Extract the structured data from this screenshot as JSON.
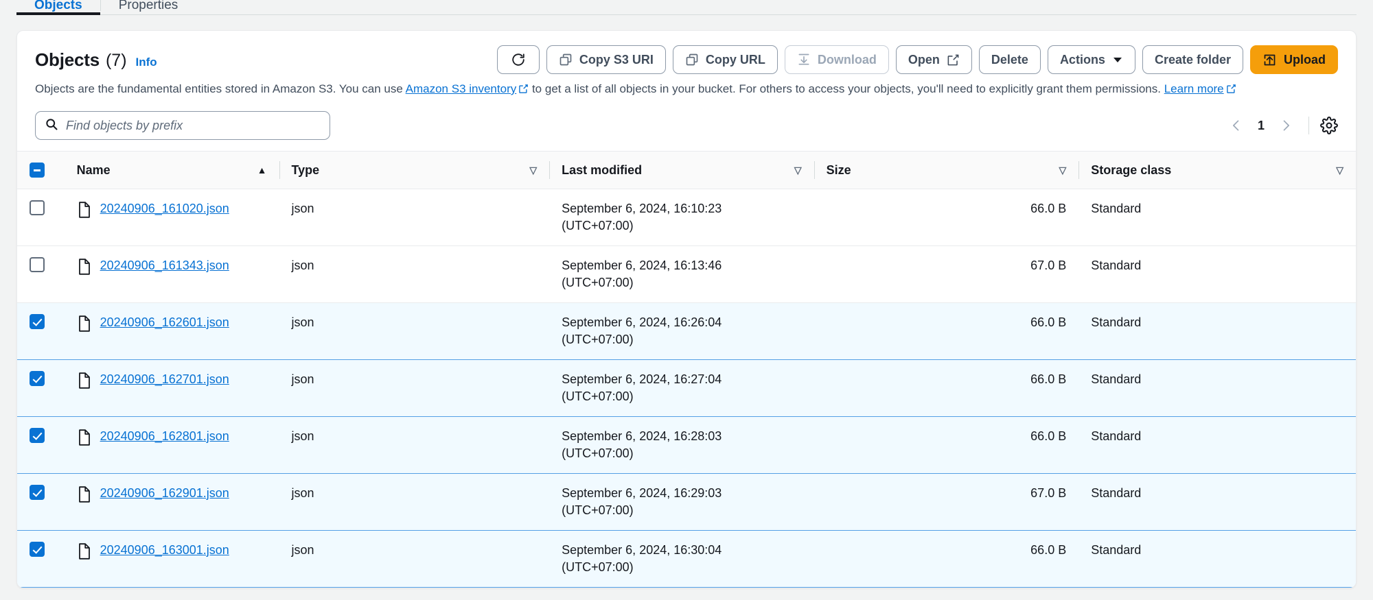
{
  "tabs": [
    {
      "label": "Objects",
      "active": true
    },
    {
      "label": "Properties",
      "active": false
    }
  ],
  "panel": {
    "title": "Objects",
    "count": "(7)",
    "info_label": "Info",
    "description_part1": "Objects are the fundamental entities stored in Amazon S3. You can use ",
    "inventory_link": "Amazon S3 inventory",
    "description_part2": " to get a list of all objects in your bucket. For others to access your objects, you'll need to explicitly grant them permissions. ",
    "learn_more_link": "Learn more"
  },
  "toolbar": {
    "refresh_icon": "refresh-icon",
    "copy_s3_uri": "Copy S3 URI",
    "copy_url": "Copy URL",
    "download": "Download",
    "open": "Open",
    "delete": "Delete",
    "actions": "Actions",
    "create_folder": "Create folder",
    "upload": "Upload",
    "upload_color": "#f59e0b"
  },
  "search": {
    "placeholder": "Find objects by prefix",
    "value": ""
  },
  "pagination": {
    "prev": "‹",
    "page": "1",
    "next": "›",
    "settings_icon": "gear-icon"
  },
  "table": {
    "select_all_state": "indeterminate",
    "columns": [
      {
        "label": "Name",
        "sort": "asc"
      },
      {
        "label": "Type",
        "sort": "none"
      },
      {
        "label": "Last modified",
        "sort": "none"
      },
      {
        "label": "Size",
        "sort": "none"
      },
      {
        "label": "Storage class",
        "sort": "none"
      }
    ],
    "rows": [
      {
        "selected": false,
        "name": "20240906_161020.json",
        "type": "json",
        "modified_date": "September 6, 2024, 16:10:23",
        "modified_tz": "(UTC+07:00)",
        "size": "66.0 B",
        "storage_class": "Standard"
      },
      {
        "selected": false,
        "name": "20240906_161343.json",
        "type": "json",
        "modified_date": "September 6, 2024, 16:13:46",
        "modified_tz": "(UTC+07:00)",
        "size": "67.0 B",
        "storage_class": "Standard"
      },
      {
        "selected": true,
        "name": "20240906_162601.json",
        "type": "json",
        "modified_date": "September 6, 2024, 16:26:04",
        "modified_tz": "(UTC+07:00)",
        "size": "66.0 B",
        "storage_class": "Standard"
      },
      {
        "selected": true,
        "name": "20240906_162701.json",
        "type": "json",
        "modified_date": "September 6, 2024, 16:27:04",
        "modified_tz": "(UTC+07:00)",
        "size": "66.0 B",
        "storage_class": "Standard"
      },
      {
        "selected": true,
        "name": "20240906_162801.json",
        "type": "json",
        "modified_date": "September 6, 2024, 16:28:03",
        "modified_tz": "(UTC+07:00)",
        "size": "66.0 B",
        "storage_class": "Standard"
      },
      {
        "selected": true,
        "name": "20240906_162901.json",
        "type": "json",
        "modified_date": "September 6, 2024, 16:29:03",
        "modified_tz": "(UTC+07:00)",
        "size": "67.0 B",
        "storage_class": "Standard"
      },
      {
        "selected": true,
        "name": "20240906_163001.json",
        "type": "json",
        "modified_date": "September 6, 2024, 16:30:04",
        "modified_tz": "(UTC+07:00)",
        "size": "66.0 B",
        "storage_class": "Standard"
      }
    ]
  }
}
